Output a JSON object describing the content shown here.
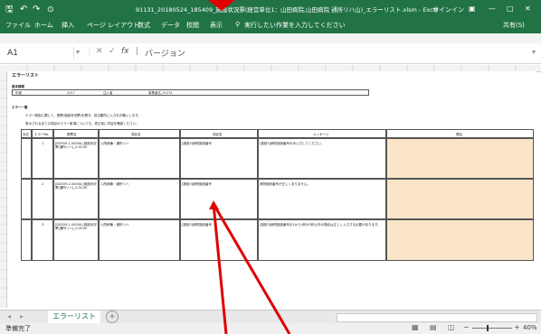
{
  "titlebar": {
    "save_icon": "save-icon",
    "title": "91131_20180524_185409_施設状況票(経営単位1：山田病院,山田病院 通所リハ山)_エラーリスト.xlsm - Excel",
    "signin": "サインイン",
    "minimize": "—",
    "maximize": "□",
    "close": "✕"
  },
  "ribbon": {
    "tabs": [
      "ファイル",
      "ホーム",
      "挿入",
      "ページ レイアウト",
      "数式",
      "データ",
      "校閲",
      "表示"
    ],
    "tell_me": "実行したい作業を入力してください",
    "share": "共有(S)"
  },
  "formula_bar": {
    "name_box": "A1",
    "cancel": "✕",
    "enter": "✓",
    "fx": "fx",
    "content": "バージョン"
  },
  "sheet": {
    "title": "エラーリスト",
    "section1": "基本情報",
    "info_row": [
      "年度",
      "2017",
      "注入者",
      "事業者名_91131"
    ],
    "section2": "エラー一覧",
    "note1": "エラー原因に関して、帳票(施設状況票)を開き、該当箇所に入力をお願いします。",
    "note2": "表示される全ての項目のエラー事項についても、修正前に内容を確認ください。",
    "headers": [
      "対応",
      "エラーNo.",
      "帳票名",
      "項目名",
      "項目名",
      "メッセージ",
      "理由"
    ],
    "rows": [
      {
        "status": "",
        "no": "1",
        "form": "[DSX09-1-0000A] 施設状況票(通所リハ)_2.00.00",
        "item1": "入院病棟・通所リハ",
        "item2": "[施設3]病院施設番号",
        "message": "[施設3]病院施設番号のみ入力してください。"
      },
      {
        "status": "",
        "no": "2",
        "form": "[DSX09-1-0000A] 施設状況票(通所リハ)_2.00.00",
        "item1": "入院病棟・通所リハ",
        "item2": "[施設3]病院施設番号",
        "message": "病院施設番号が正しくありません。"
      },
      {
        "status": "",
        "no": "3",
        "form": "[DSX09-1-0000A] 施設状況票(通所リハ)_2.00.00",
        "item1": "入院病棟・通所リハ",
        "item2": "[施設3]病院施設番号",
        "message": "[施設3]病院施設番号の1から4桁が3桁以外の場合は正しく入力する必要があります。"
      }
    ]
  },
  "bottom": {
    "sheet_tab": "エラーリスト",
    "add_sheet": "+",
    "status": "準備完了",
    "zoom": "40%"
  },
  "colors": {
    "excel_green": "#217346",
    "reason_fill": "#fbe5c8",
    "arrow_red": "#e00000"
  }
}
